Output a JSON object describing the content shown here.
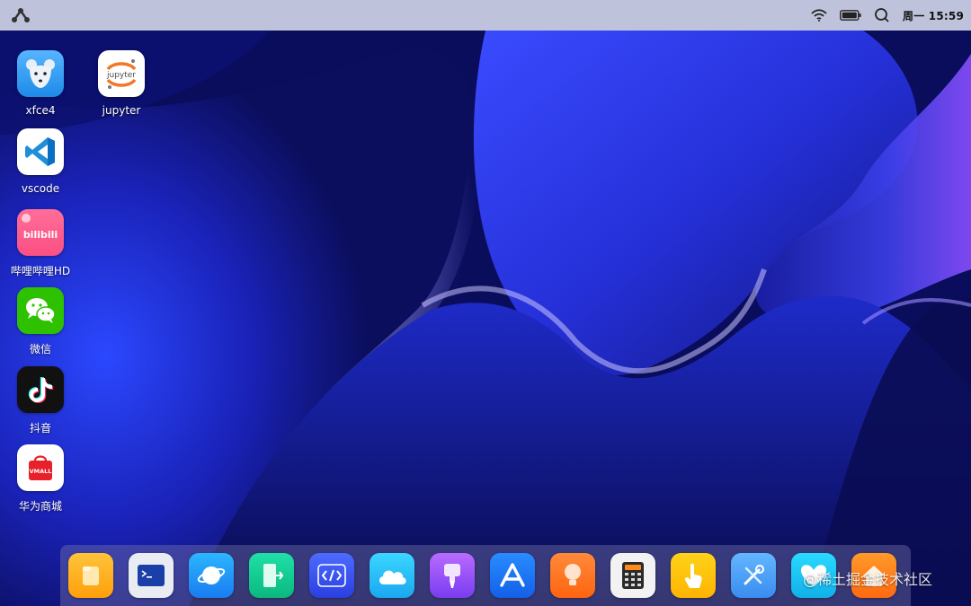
{
  "status_bar": {
    "clock": "周一 15:59",
    "icons": [
      "app-logo-icon",
      "wifi-icon",
      "battery-icon",
      "search-icon"
    ]
  },
  "desktop_icons": [
    {
      "label": "xfce4",
      "icon": "xfce-mouse-icon"
    },
    {
      "label": "jupyter",
      "icon": "jupyter-icon",
      "icon_text": "jupyter"
    },
    {
      "label": "vscode",
      "icon": "vscode-icon"
    },
    {
      "label": "哔哩哔哩HD",
      "icon": "bilibili-icon",
      "icon_text": "bilibili"
    },
    {
      "label": "微信",
      "icon": "wechat-icon"
    },
    {
      "label": "抖音",
      "icon": "douyin-icon"
    },
    {
      "label": "华为商城",
      "icon": "vmall-icon",
      "icon_text": "VMALL"
    }
  ],
  "dock": {
    "items": [
      "file-manager-icon",
      "terminal-icon",
      "browser-icon",
      "door-exit-icon",
      "code-editor-icon",
      "cloud-icon",
      "paint-brush-icon",
      "app-store-icon",
      "tips-bulb-icon",
      "calculator-icon",
      "touch-gesture-icon",
      "tools-icon",
      "health-heart-icon",
      "home-icon"
    ]
  },
  "watermark": "@稀土掘金技术社区",
  "colors": {
    "wallpaper_base": "#0a0d5c",
    "topbar": "#ced2e6",
    "accent_blue": "#1f3cff"
  }
}
